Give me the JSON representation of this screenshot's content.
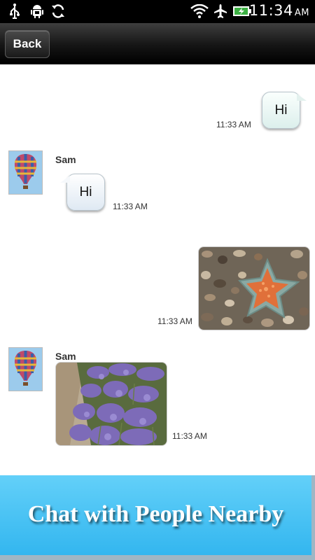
{
  "status_bar": {
    "time": "11:34",
    "ampm": "AM",
    "icons": [
      "usb-icon",
      "android-debug-icon",
      "sync-icon",
      "wifi-icon",
      "airplane-icon",
      "battery-charging-icon"
    ]
  },
  "header": {
    "back_label": "Back"
  },
  "messages": [
    {
      "direction": "outgoing",
      "type": "text",
      "text": "Hi",
      "time": "11:33 AM"
    },
    {
      "direction": "incoming",
      "sender": "Sam",
      "type": "text",
      "text": "Hi",
      "time": "11:33 AM"
    },
    {
      "direction": "outgoing",
      "type": "image",
      "image": "starfish-on-pebbles",
      "time": "11:33 AM"
    },
    {
      "direction": "incoming",
      "sender": "Sam",
      "type": "image",
      "image": "lavender-field",
      "time": "11:33 AM"
    }
  ],
  "promo": {
    "text": "Chat with People Nearby"
  },
  "colors": {
    "header_dark": "#151515",
    "promo_blue": "#33b6ef",
    "bubble_tint": "#dcefec"
  }
}
